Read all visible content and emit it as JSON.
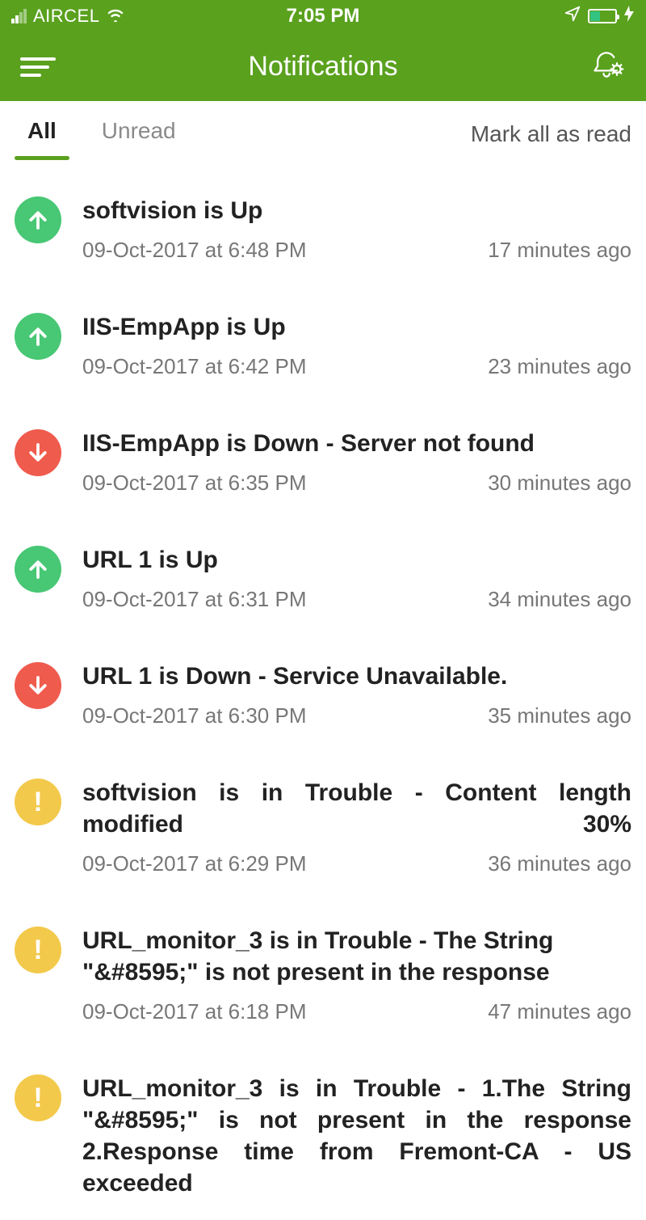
{
  "statusbar": {
    "carrier": "AIRCEL",
    "time": "7:05 PM"
  },
  "header": {
    "title": "Notifications"
  },
  "tabs": {
    "all": "All",
    "unread": "Unread",
    "mark_all": "Mark all as read"
  },
  "notifications": [
    {
      "status": "up",
      "title": "softvision is Up",
      "timestamp": "09-Oct-2017 at 6:48 PM",
      "relative": "17 minutes ago",
      "justify": false
    },
    {
      "status": "up",
      "title": "IIS-EmpApp is Up",
      "timestamp": "09-Oct-2017 at 6:42 PM",
      "relative": "23 minutes ago",
      "justify": false
    },
    {
      "status": "down",
      "title": "IIS-EmpApp is Down - Server not found",
      "timestamp": "09-Oct-2017 at 6:35 PM",
      "relative": "30 minutes ago",
      "justify": false
    },
    {
      "status": "up",
      "title": "URL 1 is Up",
      "timestamp": "09-Oct-2017 at 6:31 PM",
      "relative": "34 minutes ago",
      "justify": false
    },
    {
      "status": "down",
      "title": "URL 1 is Down - Service Unavailable.",
      "timestamp": "09-Oct-2017 at 6:30 PM",
      "relative": "35 minutes ago",
      "justify": false
    },
    {
      "status": "trouble",
      "title": "softvision is in Trouble - Content length modified 30%",
      "timestamp": "09-Oct-2017 at 6:29 PM",
      "relative": "36 minutes ago",
      "justify": true
    },
    {
      "status": "trouble",
      "title": "URL_monitor_3 is in Trouble - The String \"&#8595;\" is not present in the response",
      "timestamp": "09-Oct-2017 at 6:18 PM",
      "relative": "47 minutes ago",
      "justify": false
    },
    {
      "status": "trouble",
      "title": "URL_monitor_3 is in Trouble - 1.The String \"&#8595;\" is not present in the response\n2.Response time from Fremont-CA - US exceeded",
      "timestamp": "",
      "relative": "",
      "justify": true
    }
  ]
}
